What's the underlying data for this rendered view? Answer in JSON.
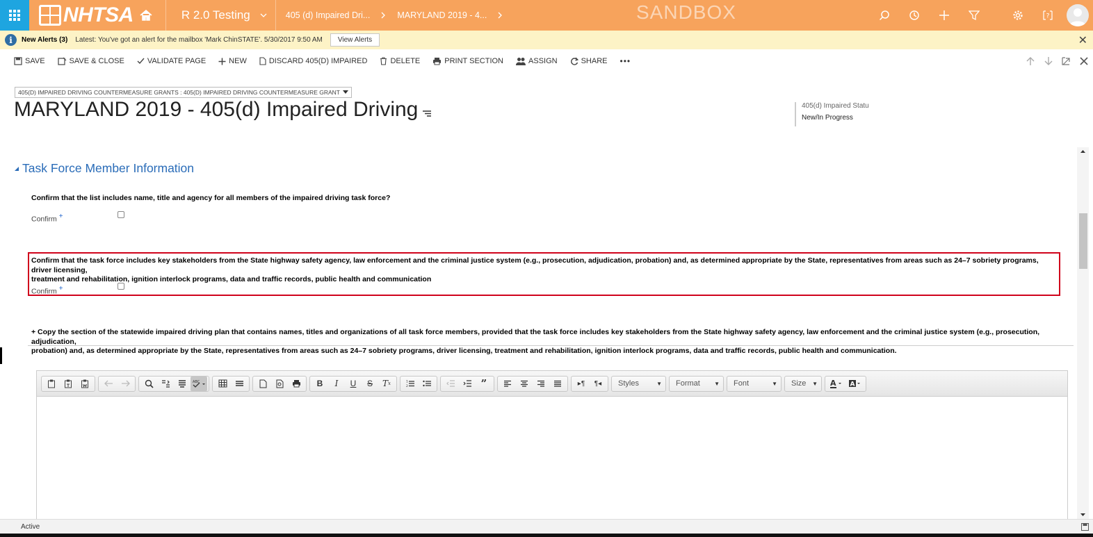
{
  "topnav": {
    "brand": "NHTSA",
    "app_name": "R 2.0 Testing",
    "crumbs": [
      "405 (d) Impaired Dri...",
      "MARYLAND 2019 - 4..."
    ],
    "environment": "SANDBOX",
    "icons": [
      "search-icon",
      "history-icon",
      "plus-icon",
      "filter-icon",
      "gear-icon",
      "help-icon",
      "avatar"
    ],
    "colors": {
      "bar": "#f7a35c",
      "waffle": "#1ea5e0"
    }
  },
  "alert": {
    "title": "New Alerts (3)",
    "message": "Latest: You've got an alert for the mailbox 'Mark ChinSTATE'. 5/30/2017 9:50 AM",
    "button": "View Alerts"
  },
  "commands": {
    "save": "SAVE",
    "save_close": "SAVE & CLOSE",
    "validate": "VALIDATE PAGE",
    "new": "NEW",
    "discard": "DISCARD 405(D) IMPAIRED",
    "delete": "DELETE",
    "print": "PRINT SECTION",
    "assign": "ASSIGN",
    "share": "SHARE",
    "more": "•••"
  },
  "record": {
    "entity_selector": "405(D) IMPAIRED DRIVING COUNTERMEASURE GRANTS : 405(D) IMPAIRED DRIVING COUNTERMEASURE GRANT",
    "title": "MARYLAND 2019 - 405(d) Impaired Driving",
    "header_field_label": "405(d) Impaired Statu",
    "header_field_value": "New/In Progress"
  },
  "section": {
    "title": "Task Force Member Information",
    "q1": "Confirm that the list includes name, title and agency for all members of the impaired driving task force?",
    "q1_label": "Confirm",
    "q2_line1": "Confirm that the task force includes key stakeholders from the State highway safety agency, law enforcement and the criminal justice system (e.g., prosecution, adjudication, probation) and, as determined appropriate by the State, representatives from areas such as 24–7 sobriety programs, driver licensing,",
    "q2_line2": "treatment and rehabilitation, ignition interlock programs, data and traffic records, public health and communication",
    "q2_label": "Confirm",
    "required_marker": "+",
    "upload_line1": "+ Copy the section of the statewide impaired driving plan that contains names, titles and organizations of all task force members, provided that the task force includes key stakeholders from the State highway safety agency, law enforcement and the criminal justice system (e.g., prosecution, adjudication,",
    "upload_line2": "probation) and, as determined appropriate by the State, representatives from areas such as 24–7 sobriety programs, driver licensing, treatment and rehabilitation, ignition interlock programs, data and traffic records, public health and communication."
  },
  "editor": {
    "dropdowns": {
      "styles": "Styles",
      "format": "Format",
      "font": "Font",
      "size": "Size"
    }
  },
  "status": {
    "text": "Active"
  }
}
